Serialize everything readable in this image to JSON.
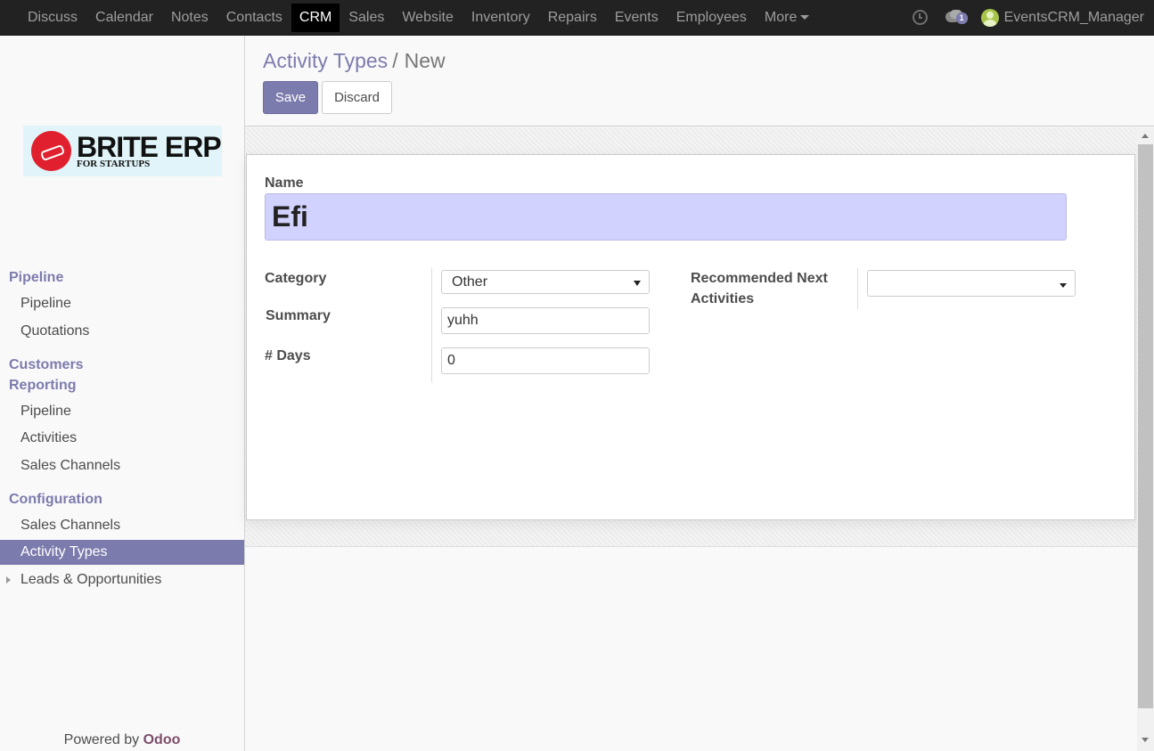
{
  "topnav": {
    "apps": [
      "Discuss",
      "Calendar",
      "Notes",
      "Contacts",
      "CRM",
      "Sales",
      "Website",
      "Inventory",
      "Repairs",
      "Events",
      "Employees"
    ],
    "active_app": "CRM",
    "more_label": "More",
    "chat_badge": "1",
    "username": "EventsCRM_Manager"
  },
  "logo": {
    "title": "BRITE ERP",
    "subtitle": "FOR STARTUPS",
    "brand_color": "#e0202f"
  },
  "sidebar": {
    "sections": [
      {
        "label": "Pipeline"
      },
      {
        "label": "Customers"
      },
      {
        "label": "Reporting"
      },
      {
        "label": "Configuration"
      }
    ],
    "pipeline_items": [
      "Pipeline",
      "Quotations"
    ],
    "reporting_items": [
      "Pipeline",
      "Activities",
      "Sales Channels"
    ],
    "configuration_items": [
      "Sales Channels",
      "Activity Types"
    ],
    "active_item": "Activity Types",
    "leads_item": "Leads & Opportunities",
    "powered_prefix": "Powered by",
    "powered_brand": "Odoo"
  },
  "breadcrumb": {
    "parent": "Activity Types",
    "separator": "/",
    "current": "New"
  },
  "buttons": {
    "save": "Save",
    "discard": "Discard"
  },
  "form": {
    "name_label": "Name",
    "name_value": "Efi",
    "category_label": "Category",
    "category_value": "Other",
    "summary_label": "Summary",
    "summary_value": "yuhh",
    "days_label": "# Days",
    "days_value": "0",
    "next_activities_label": "Recommended Next Activities",
    "next_activities_value": ""
  },
  "colors": {
    "accent": "#7c7bad",
    "name_field_bg": "#d2d2ff",
    "topbar_bg": "#222222"
  }
}
